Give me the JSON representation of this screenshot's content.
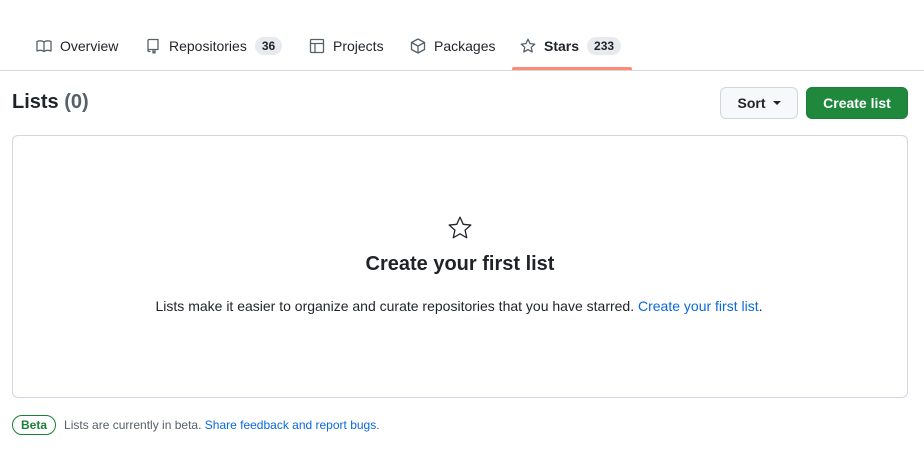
{
  "tabs": [
    {
      "label": "Overview",
      "icon": "book-icon",
      "count": null
    },
    {
      "label": "Repositories",
      "icon": "repo-icon",
      "count": "36"
    },
    {
      "label": "Projects",
      "icon": "table-icon",
      "count": null
    },
    {
      "label": "Packages",
      "icon": "package-icon",
      "count": null
    },
    {
      "label": "Stars",
      "icon": "star-icon",
      "count": "233",
      "selected": true
    }
  ],
  "colors": {
    "accent_underline": "#fd8c73",
    "primary_button": "#1f883d",
    "link": "#0969da"
  },
  "lists": {
    "heading": "Lists",
    "count": "(0)"
  },
  "toolbar": {
    "sort_label": "Sort",
    "create_label": "Create list"
  },
  "blankslate": {
    "icon": "star-icon",
    "title": "Create your first list",
    "text": "Lists make it easier to organize and curate repositories that you have starred.",
    "link": "Create your first list",
    "suffix": "."
  },
  "footer": {
    "badge": "Beta",
    "text": "Lists are currently in beta.",
    "link": "Share feedback and report bugs",
    "suffix": "."
  }
}
